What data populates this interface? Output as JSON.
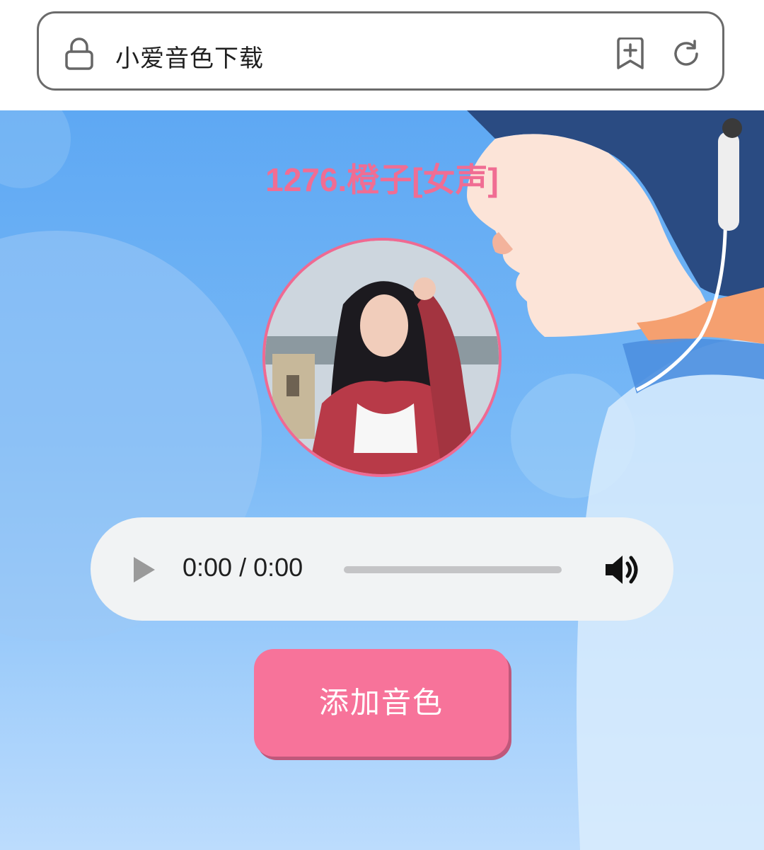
{
  "browser": {
    "url_text": "小爱音色下载",
    "lock_icon": "lock-icon",
    "bookmark_icon": "add-bookmark-icon",
    "reload_icon": "reload-icon"
  },
  "voice": {
    "title": "1276.橙子[女声]",
    "title_color": "#f06d93"
  },
  "player": {
    "time_display": "0:00 / 0:00",
    "progress": 0,
    "play_icon": "play-icon",
    "volume_icon": "volume-icon"
  },
  "actions": {
    "add_voice_label": "添加音色",
    "button_color": "#f7739a"
  }
}
